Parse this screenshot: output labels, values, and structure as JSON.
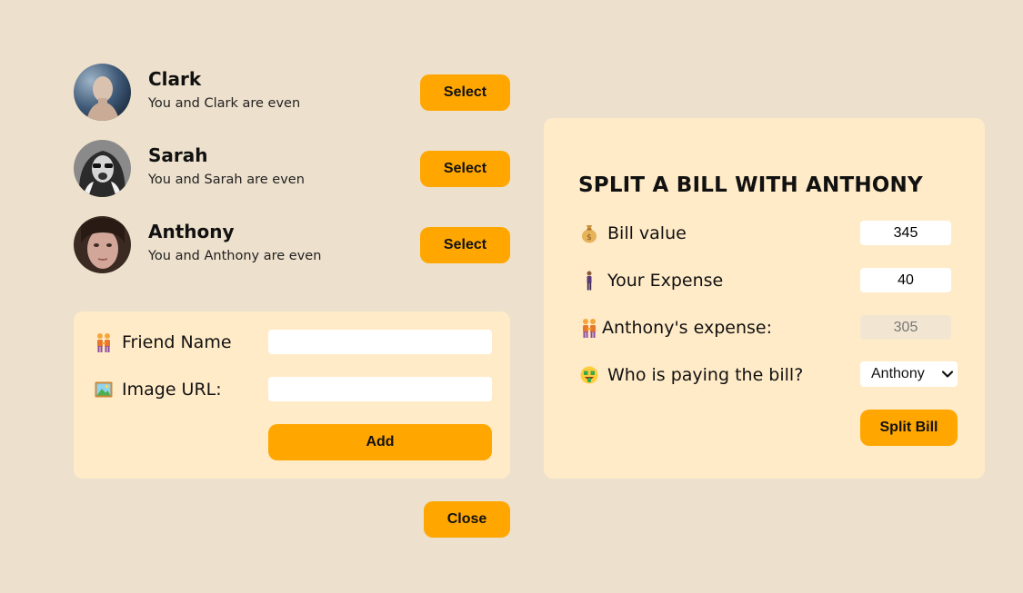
{
  "friends": [
    {
      "name": "Clark",
      "status": "You and Clark are even",
      "select_label": "Select"
    },
    {
      "name": "Sarah",
      "status": "You and Sarah are even",
      "select_label": "Select"
    },
    {
      "name": "Anthony",
      "status": "You and Anthony are even",
      "select_label": "Select"
    }
  ],
  "add_friend": {
    "name_label": "Friend Name",
    "name_value": "",
    "image_label": "Image URL:",
    "image_value": "",
    "add_label": "Add"
  },
  "close_label": "Close",
  "split": {
    "title": "SPLIT A BILL WITH ANTHONY",
    "bill_label": "Bill value",
    "bill_value": "345",
    "your_expense_label": "Your Expense",
    "your_expense_value": "40",
    "friend_expense_label": "Anthony's expense:",
    "friend_expense_value": "305",
    "payer_label": "Who is paying the bill?",
    "payer_selected": "Anthony",
    "split_label": "Split Bill"
  },
  "icons": {
    "bill": "money-bag-icon",
    "your_expense": "person-icon",
    "friend_expense": "people-holding-hands-icon",
    "payer": "money-mouth-face-icon",
    "friend_name": "people-holding-hands-icon",
    "image_url": "framed-picture-icon"
  },
  "colors": {
    "background": "#ede0cc",
    "panel": "#ffebc8",
    "accent": "#ffa600"
  }
}
